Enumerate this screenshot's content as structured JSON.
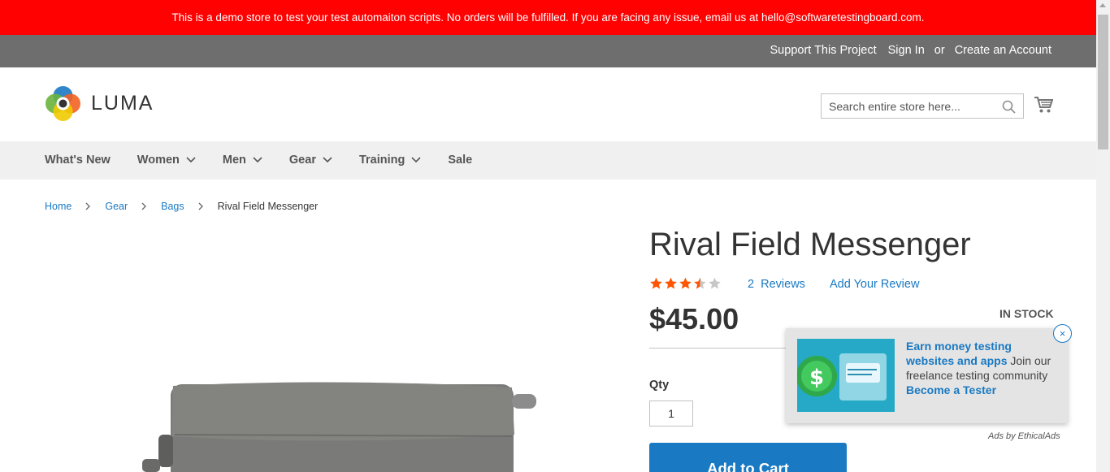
{
  "banner": {
    "text": "This is a demo store to test your test automaiton scripts. No orders will be fulfilled. If you are facing any issue, email us at hello@softwaretestingboard.com."
  },
  "top_links": {
    "support": "Support This Project",
    "sign_in": "Sign In",
    "or": "or",
    "create_account": "Create an Account"
  },
  "header": {
    "logo_text": "LUMA",
    "search_placeholder": "Search entire store here...",
    "cart_icon": "cart-icon",
    "search_icon": "search-icon"
  },
  "nav": {
    "items": [
      {
        "label": "What's New",
        "has_dropdown": false
      },
      {
        "label": "Women",
        "has_dropdown": true
      },
      {
        "label": "Men",
        "has_dropdown": true
      },
      {
        "label": "Gear",
        "has_dropdown": true
      },
      {
        "label": "Training",
        "has_dropdown": true
      },
      {
        "label": "Sale",
        "has_dropdown": false
      }
    ]
  },
  "breadcrumb": {
    "items": [
      "Home",
      "Gear",
      "Bags"
    ],
    "current": "Rival Field Messenger"
  },
  "product": {
    "name": "Rival Field Messenger",
    "rating_stars": 3.5,
    "rating_max": 5,
    "reviews_count": "2",
    "reviews_label": "Reviews",
    "add_review": "Add Your Review",
    "price": "$45.00",
    "stock": "IN STOCK",
    "qty_label": "Qty",
    "qty_value": "1",
    "add_to_cart": "Add to Cart"
  },
  "ad": {
    "headline": "Earn money testing websites and apps",
    "body": " Join our freelance testing community ",
    "cta": "Become a Tester",
    "attribution": "Ads by EthicalAds",
    "close": "×"
  },
  "colors": {
    "banner_bg": "#ff0101",
    "top_bar_bg": "#6e6e6e",
    "nav_bg": "#f0f0f0",
    "link": "#1979c3",
    "star": "#ff5501",
    "button": "#1979c3"
  }
}
